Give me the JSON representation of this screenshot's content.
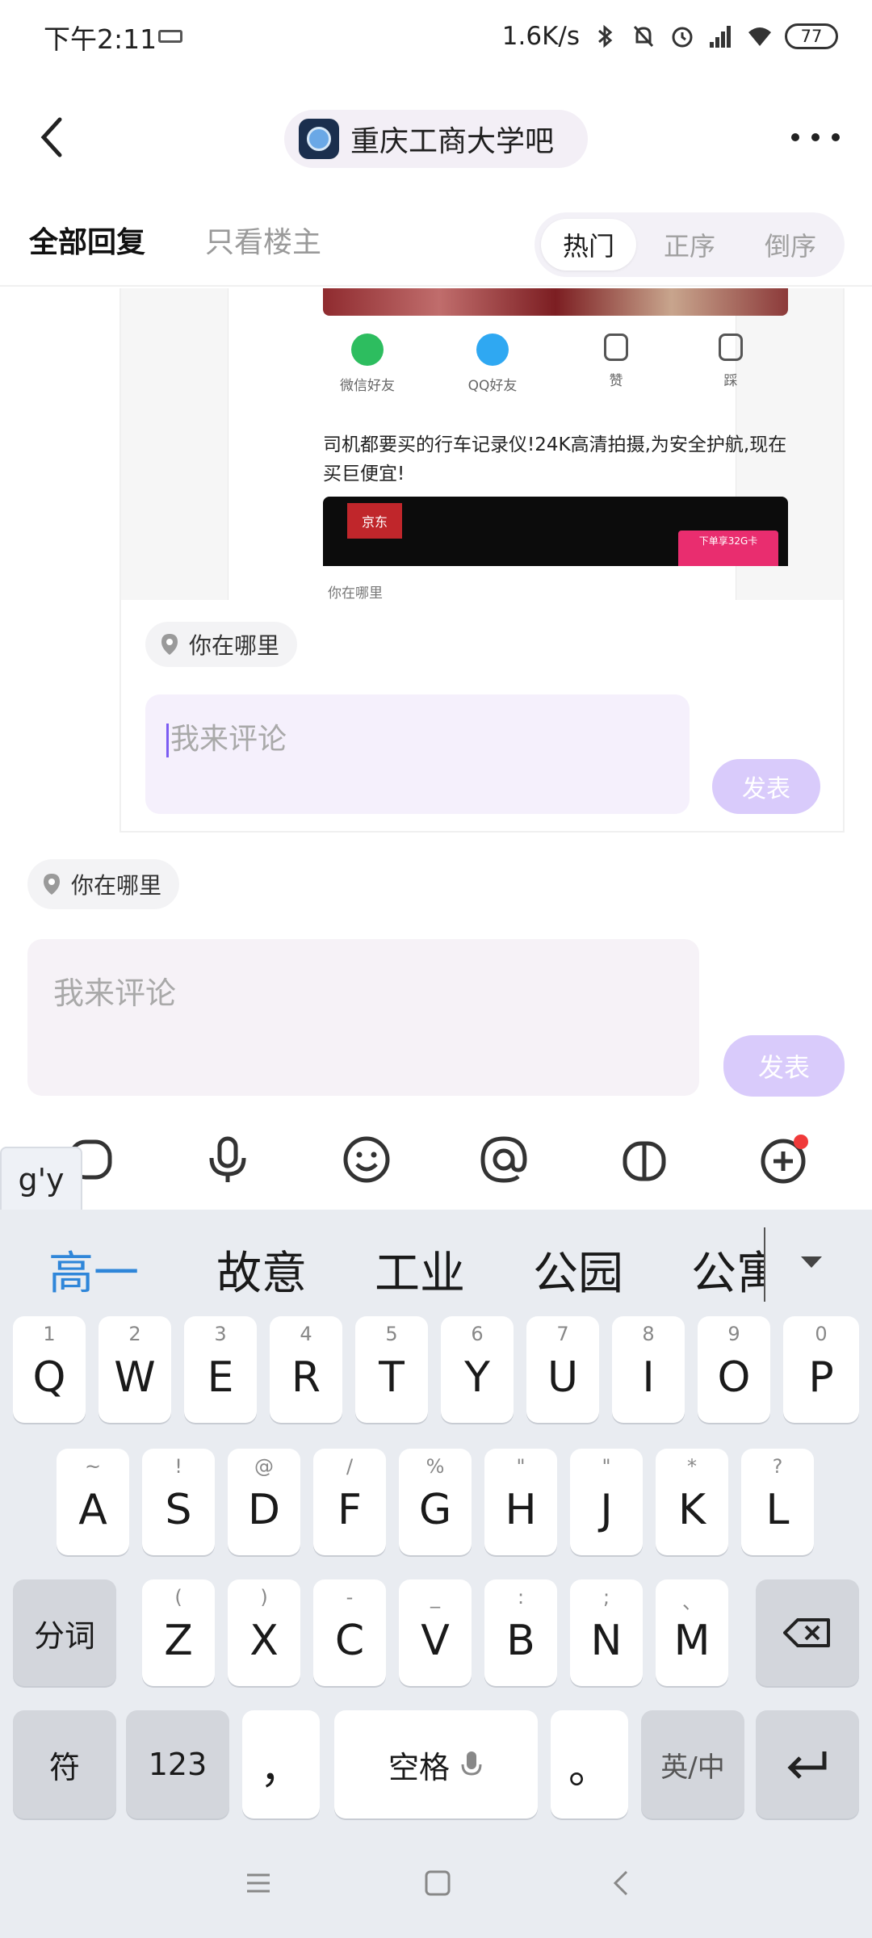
{
  "status_bar": {
    "time": "下午2:11",
    "net_speed": "1.6K/s",
    "battery": "77"
  },
  "header": {
    "forum_name": "重庆工商大学吧"
  },
  "tabs": {
    "all_replies": "全部回复",
    "op_only": "只看楼主",
    "sort": [
      "热门",
      "正序",
      "倒序"
    ],
    "sort_active": "热门"
  },
  "embedded_screenshot": {
    "share_items": [
      "微信好友",
      "QQ好友",
      "赞",
      "踩"
    ],
    "ad_text": "司机都要买的行车记录仪!24K高清拍摄,为安全护航,现在买巨便宜!",
    "ad_brand": "京东",
    "ad_tag": "下单享32G卡",
    "location": "你在哪里"
  },
  "inner_reply": {
    "location_label": "你在哪里",
    "comment_placeholder": "我来评论",
    "post_label": "发表"
  },
  "main_reply": {
    "location_label": "你在哪里",
    "comment_placeholder": "我来评论",
    "post_label": "发表"
  },
  "toolbar": {
    "icons": [
      "image-icon",
      "microphone-icon",
      "emoji-icon",
      "at-icon",
      "gift-icon",
      "plus-icon"
    ]
  },
  "ime": {
    "pinyin": "g'y",
    "candidates": [
      "高一",
      "故意",
      "工业",
      "公园",
      "公寓"
    ],
    "row1": [
      {
        "key": "Q",
        "hint": "1"
      },
      {
        "key": "W",
        "hint": "2"
      },
      {
        "key": "E",
        "hint": "3"
      },
      {
        "key": "R",
        "hint": "4"
      },
      {
        "key": "T",
        "hint": "5"
      },
      {
        "key": "Y",
        "hint": "6"
      },
      {
        "key": "U",
        "hint": "7"
      },
      {
        "key": "I",
        "hint": "8"
      },
      {
        "key": "O",
        "hint": "9"
      },
      {
        "key": "P",
        "hint": "0"
      }
    ],
    "row2": [
      {
        "key": "A",
        "hint": "~"
      },
      {
        "key": "S",
        "hint": "!"
      },
      {
        "key": "D",
        "hint": "@"
      },
      {
        "key": "F",
        "hint": "/"
      },
      {
        "key": "G",
        "hint": "%"
      },
      {
        "key": "H",
        "hint": "\""
      },
      {
        "key": "J",
        "hint": "\""
      },
      {
        "key": "K",
        "hint": "*"
      },
      {
        "key": "L",
        "hint": "?"
      }
    ],
    "row3": [
      {
        "key": "Z",
        "hint": "("
      },
      {
        "key": "X",
        "hint": ")"
      },
      {
        "key": "C",
        "hint": "-"
      },
      {
        "key": "V",
        "hint": "_"
      },
      {
        "key": "B",
        "hint": ":"
      },
      {
        "key": "N",
        "hint": ";"
      },
      {
        "key": "M",
        "hint": "、"
      }
    ],
    "segment_key": "分词",
    "symbol_key": "符",
    "num_key": "123",
    "comma_key": "，",
    "space_key": "空格",
    "period_key": "。",
    "lang_key": "英/中"
  }
}
